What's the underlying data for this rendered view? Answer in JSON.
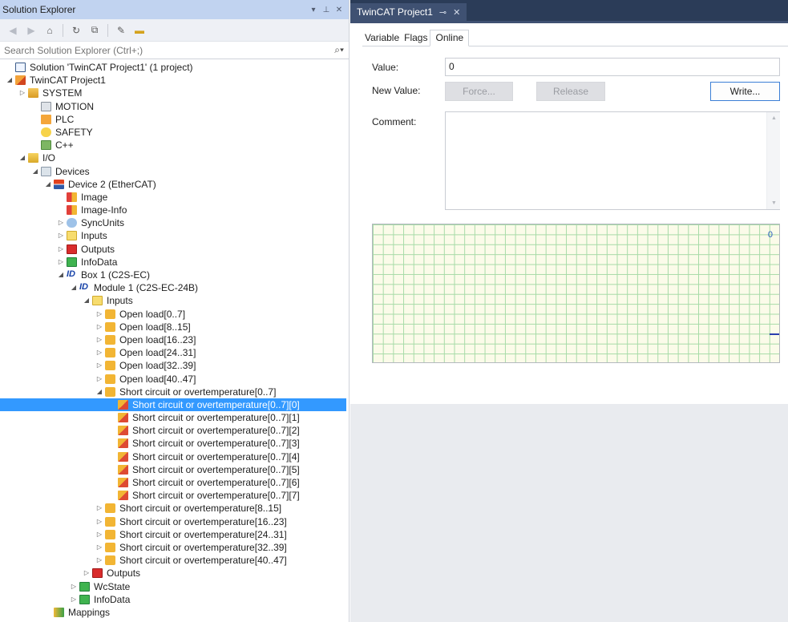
{
  "solution_explorer": {
    "title": "Solution Explorer",
    "title_controls": [
      "▾",
      "⊥",
      "✕"
    ],
    "search_placeholder": "Search Solution Explorer (Ctrl+;)",
    "tree": [
      {
        "label": "Solution 'TwinCAT Project1' (1 project)",
        "icon": "solution-icon",
        "arrow": ""
      },
      {
        "label": "TwinCAT Project1",
        "icon": "project-icon",
        "arrow": "◢"
      },
      {
        "label": "SYSTEM",
        "icon": "system-icon",
        "arrow": "▷"
      },
      {
        "label": "MOTION",
        "icon": "motion-icon",
        "arrow": ""
      },
      {
        "label": "PLC",
        "icon": "plc-icon",
        "arrow": ""
      },
      {
        "label": "SAFETY",
        "icon": "safety-icon",
        "arrow": ""
      },
      {
        "label": "C++",
        "icon": "cpp-icon",
        "arrow": ""
      },
      {
        "label": "I/O",
        "icon": "io-icon",
        "arrow": "◢"
      },
      {
        "label": "Devices",
        "icon": "devices-icon",
        "arrow": "◢"
      },
      {
        "label": "Device 2 (EtherCAT)",
        "icon": "ethercat-device-icon",
        "arrow": "◢"
      },
      {
        "label": "Image",
        "icon": "image-icon",
        "arrow": ""
      },
      {
        "label": "Image-Info",
        "icon": "image-info-icon",
        "arrow": ""
      },
      {
        "label": "SyncUnits",
        "icon": "syncunits-icon",
        "arrow": "▷"
      },
      {
        "label": "Inputs",
        "icon": "inputs-icon",
        "arrow": "▷"
      },
      {
        "label": "Outputs",
        "icon": "outputs-icon",
        "arrow": "▷"
      },
      {
        "label": "InfoData",
        "icon": "infodata-icon",
        "arrow": "▷"
      },
      {
        "label": "Box 1 (C2S-EC)",
        "icon": "box-icon",
        "arrow": "◢"
      },
      {
        "label": "Module 1 (C2S-EC-24B)",
        "icon": "module-icon",
        "arrow": "◢"
      },
      {
        "label": "Inputs",
        "icon": "inputs-icon",
        "arrow": "◢"
      },
      {
        "label": "Open load[0..7]",
        "icon": "variable-icon",
        "arrow": "▷"
      },
      {
        "label": "Open load[8..15]",
        "icon": "variable-icon",
        "arrow": "▷"
      },
      {
        "label": "Open load[16..23]",
        "icon": "variable-icon",
        "arrow": "▷"
      },
      {
        "label": "Open load[24..31]",
        "icon": "variable-icon",
        "arrow": "▷"
      },
      {
        "label": "Open load[32..39]",
        "icon": "variable-icon",
        "arrow": "▷"
      },
      {
        "label": "Open load[40..47]",
        "icon": "variable-icon",
        "arrow": "▷"
      },
      {
        "label": "Short circuit or overtemperature[0..7]",
        "icon": "variable-icon",
        "arrow": "◢"
      },
      {
        "label": "Short circuit or overtemperature[0..7][0]",
        "icon": "bit-variable-icon",
        "arrow": ""
      },
      {
        "label": "Short circuit or overtemperature[0..7][1]",
        "icon": "bit-variable-icon",
        "arrow": ""
      },
      {
        "label": "Short circuit or overtemperature[0..7][2]",
        "icon": "bit-variable-icon",
        "arrow": ""
      },
      {
        "label": "Short circuit or overtemperature[0..7][3]",
        "icon": "bit-variable-icon",
        "arrow": ""
      },
      {
        "label": "Short circuit or overtemperature[0..7][4]",
        "icon": "bit-variable-icon",
        "arrow": ""
      },
      {
        "label": "Short circuit or overtemperature[0..7][5]",
        "icon": "bit-variable-icon",
        "arrow": ""
      },
      {
        "label": "Short circuit or overtemperature[0..7][6]",
        "icon": "bit-variable-icon",
        "arrow": ""
      },
      {
        "label": "Short circuit or overtemperature[0..7][7]",
        "icon": "bit-variable-icon",
        "arrow": ""
      },
      {
        "label": "Short circuit or overtemperature[8..15]",
        "icon": "variable-icon",
        "arrow": "▷"
      },
      {
        "label": "Short circuit or overtemperature[16..23]",
        "icon": "variable-icon",
        "arrow": "▷"
      },
      {
        "label": "Short circuit or overtemperature[24..31]",
        "icon": "variable-icon",
        "arrow": "▷"
      },
      {
        "label": "Short circuit or overtemperature[32..39]",
        "icon": "variable-icon",
        "arrow": "▷"
      },
      {
        "label": "Short circuit or overtemperature[40..47]",
        "icon": "variable-icon",
        "arrow": "▷"
      },
      {
        "label": "Outputs",
        "icon": "outputs-icon",
        "arrow": "▷"
      },
      {
        "label": "WcState",
        "icon": "wcstate-icon",
        "arrow": "▷"
      },
      {
        "label": "InfoData",
        "icon": "infodata-icon",
        "arrow": "▷"
      },
      {
        "label": "Mappings",
        "icon": "mappings-icon",
        "arrow": ""
      }
    ],
    "selected_label": "Short circuit or overtemperature[0..7][0]"
  },
  "document": {
    "tab_title": "TwinCAT Project1",
    "tab_pin": "⊸",
    "tab_close": "✕",
    "subtabs": [
      {
        "label": "Variable",
        "active": false
      },
      {
        "label": "Flags",
        "active": false
      },
      {
        "label": "Online",
        "active": true
      }
    ],
    "value_label": "Value:",
    "value": "0",
    "new_value_label": "New Value:",
    "force_label": "Force...",
    "release_label": "Release",
    "write_label": "Write...",
    "comment_label": "Comment:",
    "comment": "",
    "graph_value": "0"
  },
  "colors": {
    "selection": "#3399ff",
    "title_bar": "#c1d3f0",
    "doc_tab": "#3f5172",
    "grid_line": "#a7dba7",
    "graph_bg": "#fbfbe9"
  }
}
